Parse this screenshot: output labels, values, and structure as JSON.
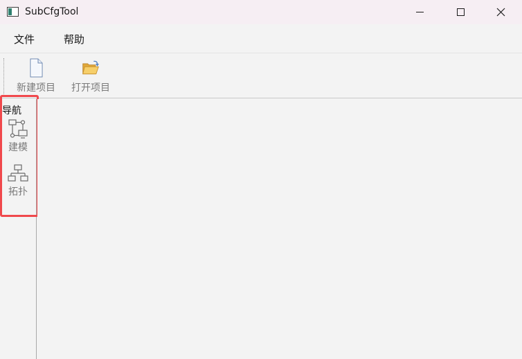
{
  "window": {
    "title": "SubCfgTool",
    "icon": "app-window-icon"
  },
  "window_controls": {
    "minimize_icon": "minimize-icon",
    "maximize_icon": "maximize-icon",
    "close_icon": "close-icon"
  },
  "menu": {
    "items": [
      {
        "label": "文件"
      },
      {
        "label": "帮助"
      }
    ]
  },
  "toolbar": {
    "new_project": {
      "label": "新建项目",
      "icon": "new-file-icon"
    },
    "open_project": {
      "label": "打开项目",
      "icon": "open-folder-icon"
    }
  },
  "nav": {
    "title": "导航",
    "items": [
      {
        "label": "建模",
        "icon": "model-diagram-icon"
      },
      {
        "label": "拓扑",
        "icon": "topology-icon"
      }
    ]
  },
  "colors": {
    "highlight": "#f0484c",
    "titlebar_bg": "#f6eef3",
    "window_bg": "#f3f3f3"
  }
}
